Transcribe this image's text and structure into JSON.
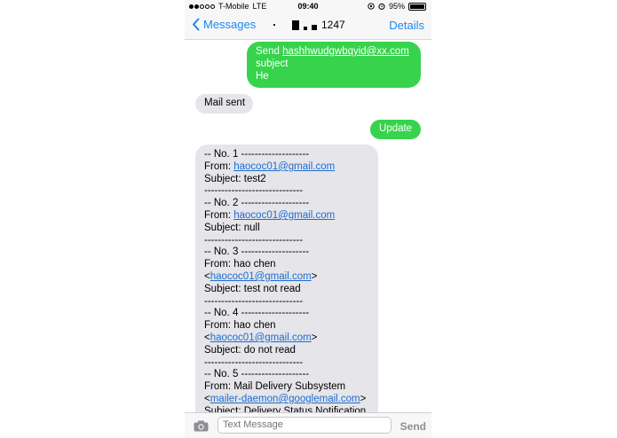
{
  "status": {
    "carrier": "T-Mobile",
    "network": "LTE",
    "time": "09:40",
    "battery": "95%",
    "battery_level": 0.95
  },
  "nav": {
    "back_label": "Messages",
    "title_suffix": "1247",
    "details_label": "Details"
  },
  "messages": {
    "m1": {
      "line1_prefix": "Send ",
      "line1_email": "hashhwudgwbqyid@xx.com",
      "line2": "subject",
      "line3": "He"
    },
    "m2": {
      "text": "Mail sent"
    },
    "m3": {
      "text": "Update"
    },
    "m4": {
      "lines": [
        "-- No. 1 --------------------",
        "From: ",
        "haococ01@gmail.com",
        "Subject: test2",
        "-----------------------------",
        "-- No. 2 --------------------",
        "From: ",
        "haococ01@gmail.com",
        "Subject: null",
        "-----------------------------",
        "-- No. 3 --------------------",
        "From: hao chen",
        "<",
        "haococ01@gmail.com",
        ">",
        "Subject: test not read",
        "-----------------------------",
        "-- No. 4 --------------------",
        "From: hao chen",
        "<",
        "haococ01@gmail.com",
        ">",
        "Subject: do not read",
        "-----------------------------",
        "-- No. 5 --------------------",
        "From: Mail Delivery Subsystem",
        "<",
        "mailer-daemon@googlemail.com",
        ">",
        "Subject: Delivery Status Notification"
      ]
    }
  },
  "input": {
    "placeholder": "Text Message",
    "send_label": "Send"
  },
  "icons": {
    "back": "chevron-left-icon",
    "camera": "camera-icon",
    "signal": "signal-dots-icon",
    "location": "location-icon",
    "alarm": "alarm-icon",
    "battery": "battery-icon"
  },
  "colors": {
    "accent": "#1c86f2",
    "sent_bubble": "#37d34d",
    "received_bubble": "#e5e5ea"
  }
}
